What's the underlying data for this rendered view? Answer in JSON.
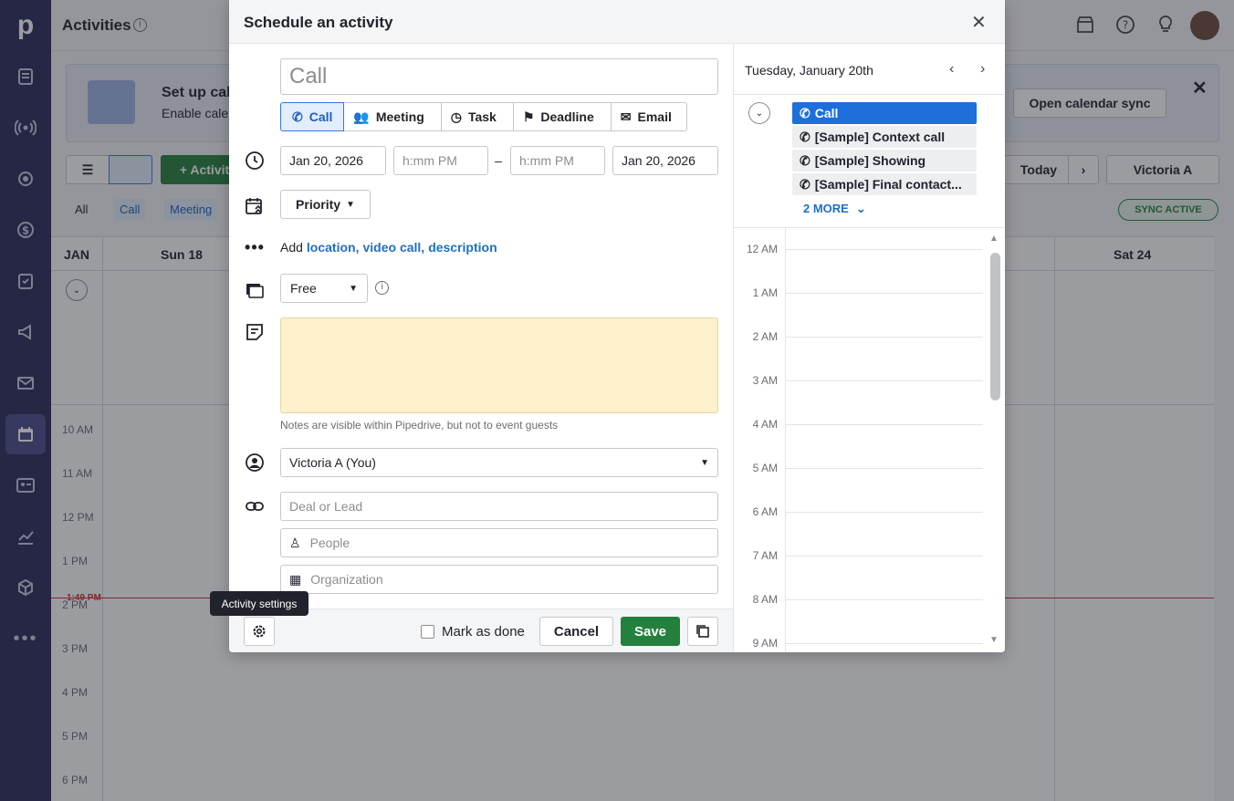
{
  "app": {
    "page_title": "Activities",
    "banner_title": "Set up cal",
    "banner_subtitle": "Enable cale",
    "open_calendar_sync": "Open calendar sync",
    "add_activity": "+ Activit",
    "today": "Today",
    "user_filter": "Victoria A",
    "filter_all": "All",
    "filter_call": "Call",
    "filter_meeting": "Meeting",
    "sync_badge": "SYNC ACTIVE",
    "month": "JAN",
    "day_sun": "Sun 18",
    "day_sat": "Sat 24",
    "hours": [
      "10 AM",
      "11 AM",
      "12 PM",
      "1 PM",
      "2 PM",
      "3 PM",
      "4 PM",
      "5 PM",
      "6 PM"
    ],
    "now_time": "1:49 PM"
  },
  "modal": {
    "title": "Schedule an activity",
    "subject_placeholder": "Call",
    "types": [
      {
        "label": "Call",
        "icon": "phone-icon",
        "selected": true
      },
      {
        "label": "Meeting",
        "icon": "people-icon",
        "selected": false
      },
      {
        "label": "Task",
        "icon": "clock-icon",
        "selected": false
      },
      {
        "label": "Deadline",
        "icon": "flag-icon",
        "selected": false
      },
      {
        "label": "Email",
        "icon": "envelope-icon",
        "selected": false
      }
    ],
    "start_date": "Jan 20, 2026",
    "start_time_placeholder": "h:mm PM",
    "dash": "–",
    "end_time_placeholder": "h:mm PM",
    "end_date": "Jan 20, 2026",
    "priority_label": "Priority",
    "add_prefix": "Add",
    "add_links": [
      "location,",
      "video call,",
      "description"
    ],
    "busy_value": "Free",
    "notes_hint": "Notes are visible within Pipedrive, but not to event guests",
    "owner": "Victoria A (You)",
    "deal_placeholder": "Deal or Lead",
    "people_placeholder": "People",
    "org_placeholder": "Organization",
    "mark_done": "Mark as done",
    "cancel": "Cancel",
    "save": "Save",
    "tooltip": "Activity settings"
  },
  "day_panel": {
    "date": "Tuesday, January 20th",
    "events": [
      "Call",
      "[Sample] Context call",
      "[Sample] Showing",
      "[Sample] Final contact..."
    ],
    "more": "2 MORE",
    "hours": [
      "12 AM",
      "1 AM",
      "2 AM",
      "3 AM",
      "4 AM",
      "5 AM",
      "6 AM",
      "7 AM",
      "8 AM",
      "9 AM"
    ]
  },
  "colors": {
    "sidebar": "#2b2b5a",
    "primary_blue": "#317ae2",
    "save_green": "#24803d",
    "notes_bg": "#fdf1cc"
  }
}
